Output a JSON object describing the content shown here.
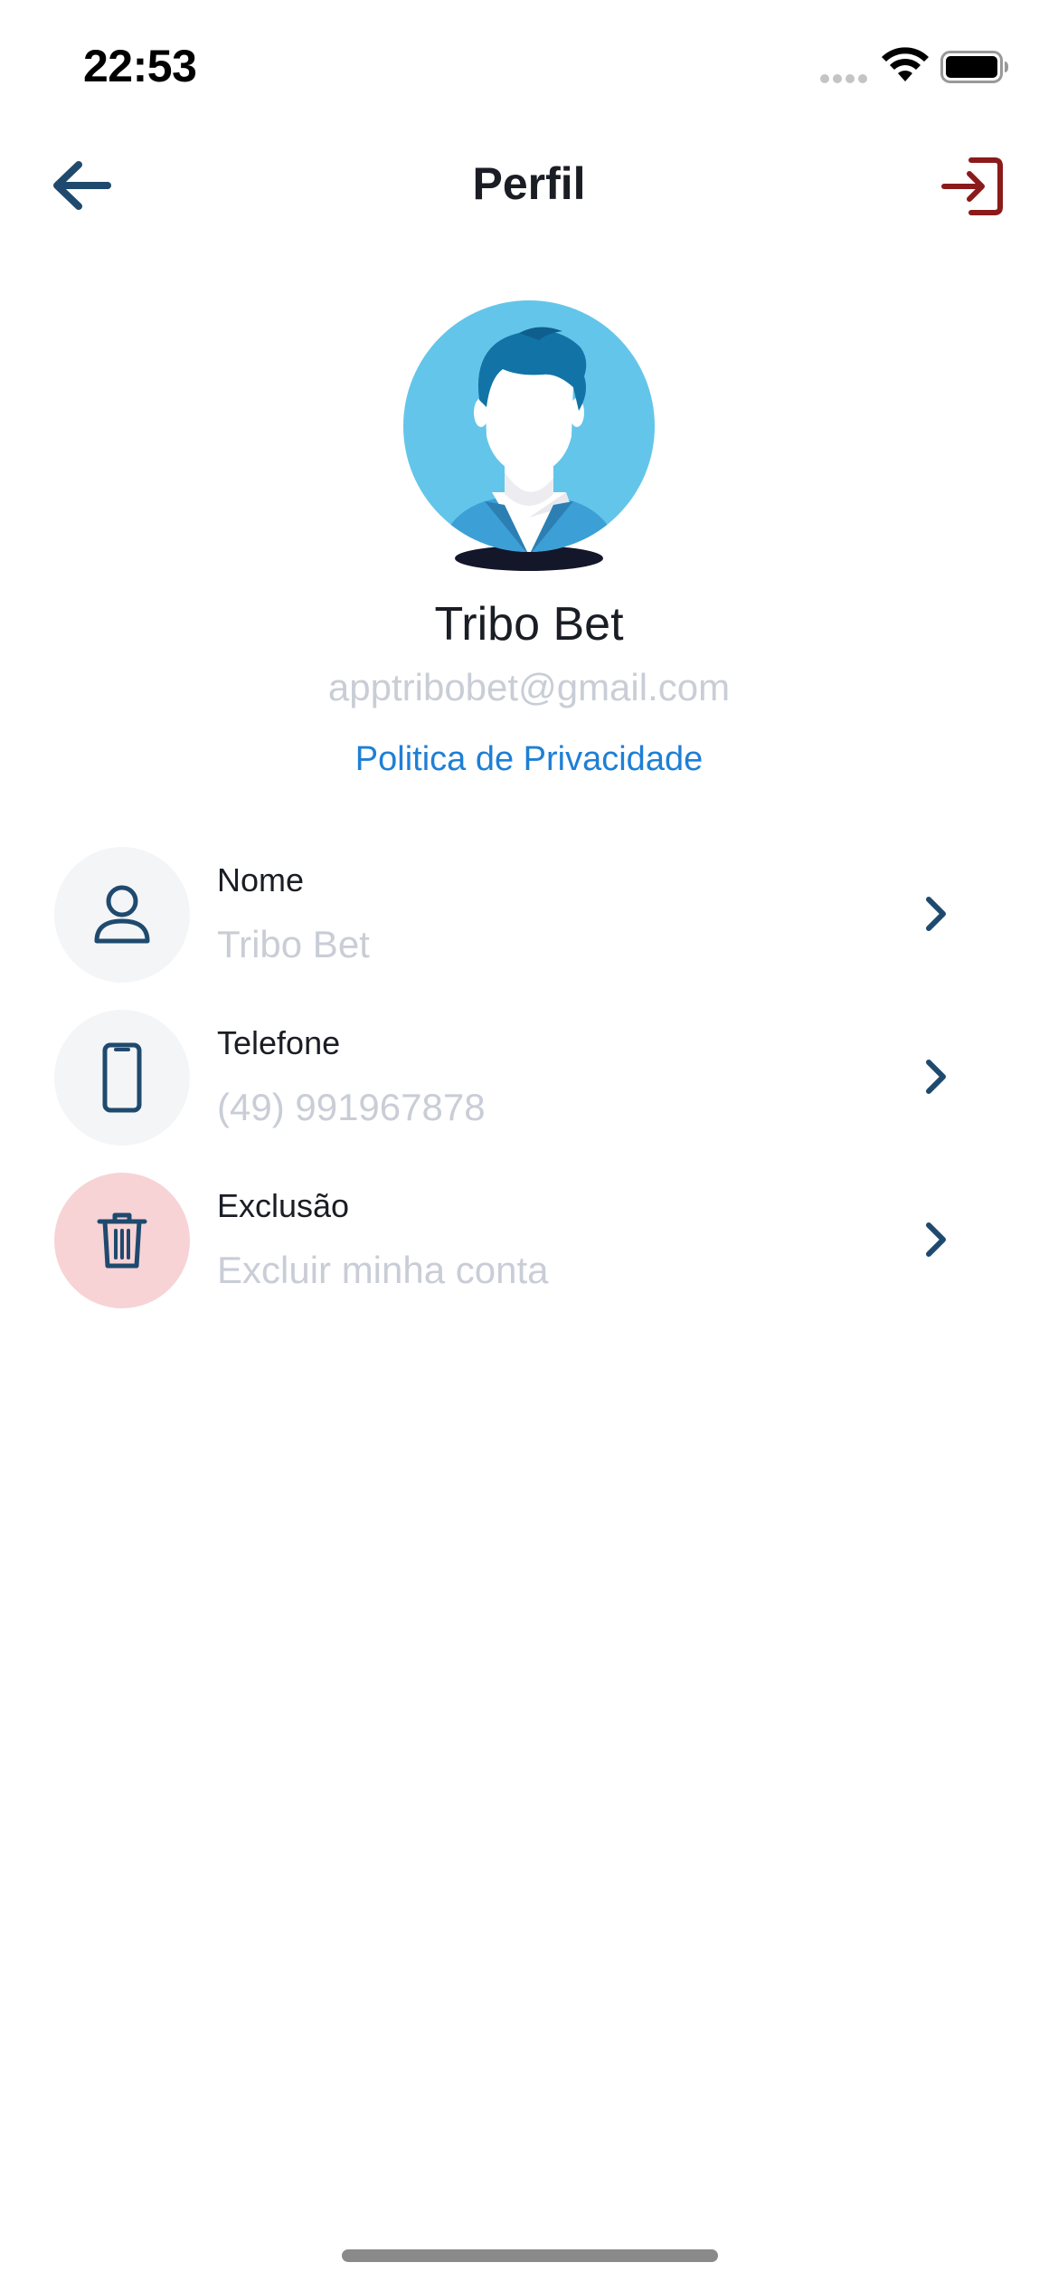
{
  "status_bar": {
    "time": "22:53"
  },
  "header": {
    "title": "Perfil",
    "back_icon": "arrow-left-icon",
    "logout_icon": "logout-icon"
  },
  "profile": {
    "name": "Tribo Bet",
    "email": "apptribobet@gmail.com",
    "privacy_link": "Politica de Privacidade"
  },
  "items": [
    {
      "label": "Nome",
      "value": "Tribo Bet",
      "icon": "user-icon"
    },
    {
      "label": "Telefone",
      "value": "(49) 991967878",
      "icon": "phone-icon"
    },
    {
      "label": "Exclusão",
      "value": "Excluir minha conta",
      "icon": "trash-icon"
    }
  ],
  "colors": {
    "primary_dark": "#1f4a6e",
    "logout_red": "#8b1a1a",
    "link_blue": "#1e7fd6",
    "muted_text": "#c9cdd6",
    "icon_bg": "#f4f5f7",
    "danger_bg": "#f7d3d6"
  }
}
